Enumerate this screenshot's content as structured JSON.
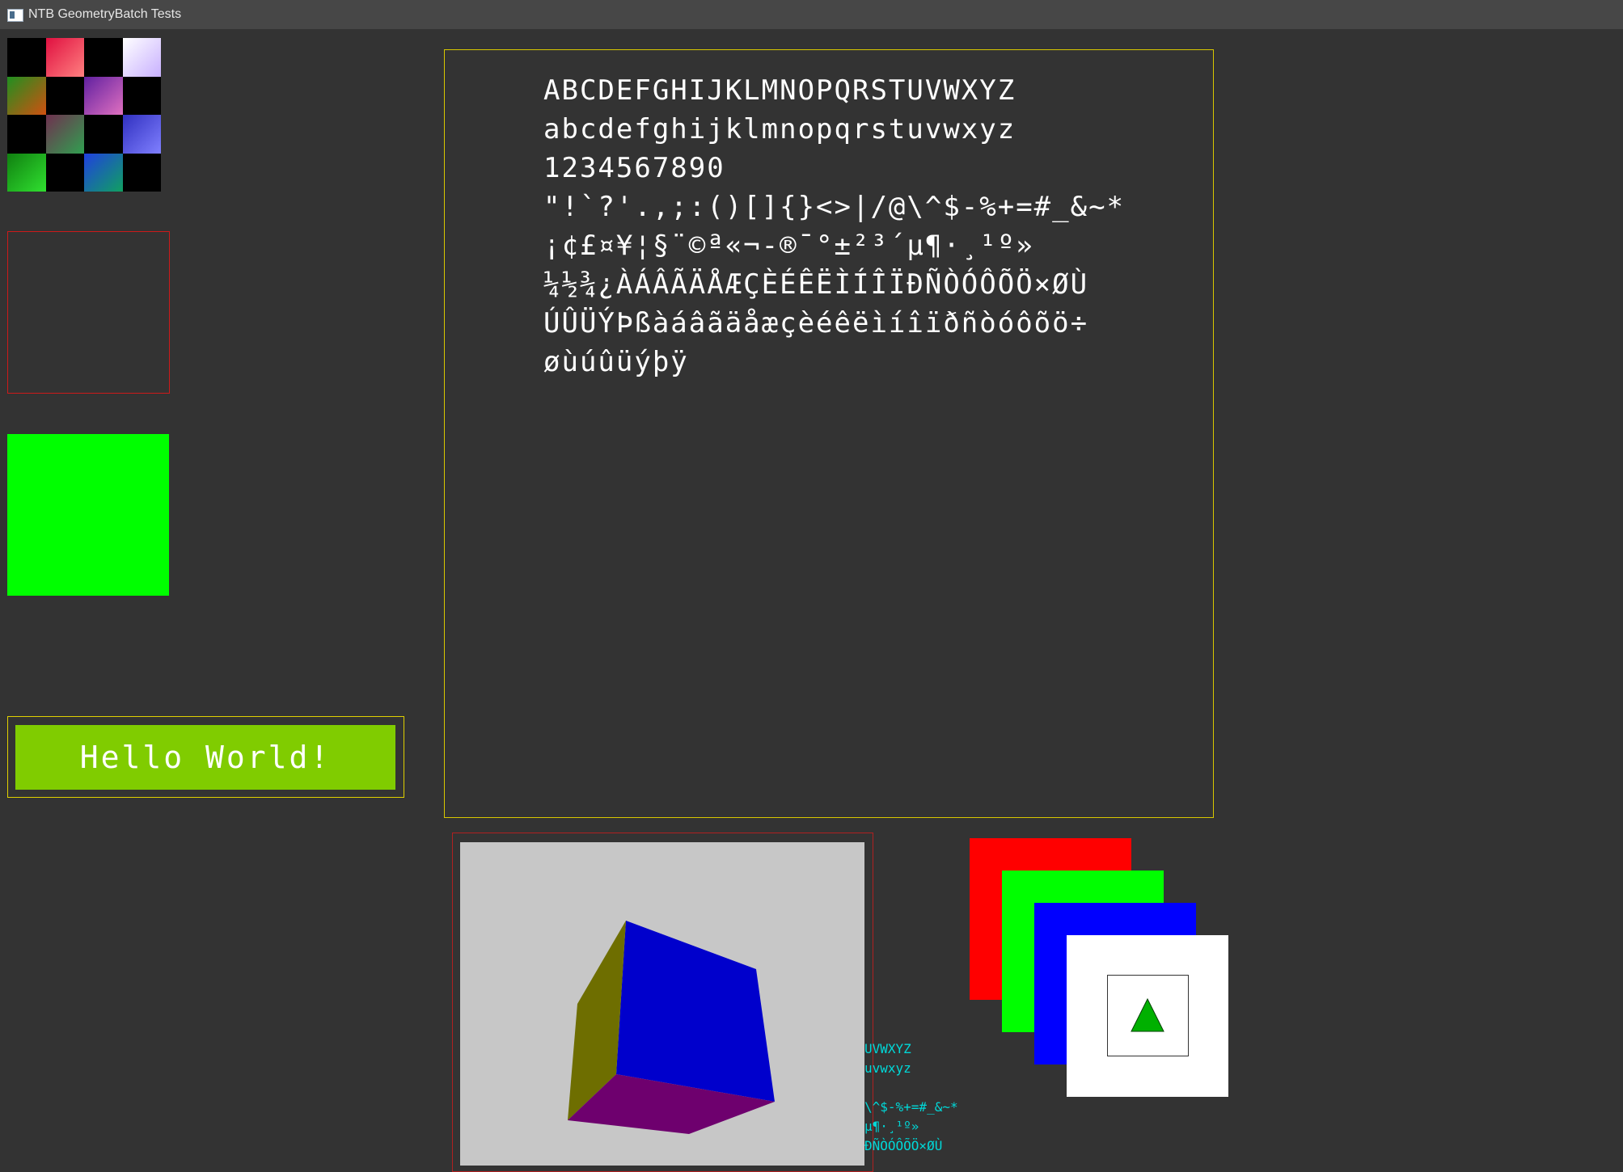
{
  "window": {
    "title": "NTB GeometryBatch Tests"
  },
  "checkerboard": {
    "cells": [
      [
        "#000000",
        "linear-gradient(to bottom right,#e01040,#ff8080)",
        "#000000",
        "linear-gradient(to bottom right,#ffffff,#c8b0ff)"
      ],
      [
        "linear-gradient(to bottom right,#209020,#d05010)",
        "#000000",
        "linear-gradient(to bottom right,#6020a0,#e070c0)",
        "#000000"
      ],
      [
        "#000000",
        "linear-gradient(to bottom right,#703050,#30a050)",
        "#000000",
        "linear-gradient(to bottom right,#3030c0,#8080ff)"
      ],
      [
        "linear-gradient(to bottom right,#108010,#30e030)",
        "#000000",
        "linear-gradient(to bottom right,#2040e0,#10a060)",
        "#000000"
      ]
    ]
  },
  "hello_button": {
    "label": "Hello World!"
  },
  "font_sample": {
    "lines": [
      "ABCDEFGHIJKLMNOPQRSTUVWXYZ",
      "abcdefghijklmnopqrstuvwxyz",
      "1234567890",
      "\"!`?'.,;:()[]{}<>|/@\\^$-%+=#_&~*",
      "¡¢£¤¥¦§¨©ª«¬-®¯°±²³´µ¶·¸¹º»",
      "¼½¾¿ÀÁÂÃÄÅÆÇÈÉÊËÌÍÎÏÐÑÒÓÔÕÖ×ØÙ",
      "ÚÛÜÝÞßàáâãäåæçèéêëìíîïðñòóôõö÷",
      "øùúûüýþÿ"
    ]
  },
  "clipped_text": {
    "lines": [
      "UVWXYZ",
      "uvwxyz",
      "",
      "\\^$-%+=#_&~*",
      "µ¶·¸¹º»",
      "ÐÑÒÓÔÕÖ×ØÙ"
    ]
  },
  "colors": {
    "cube_top": "#0000cc",
    "cube_left": "#6e6e00",
    "cube_bottom": "#6e006e",
    "triangle": "#00b000"
  }
}
